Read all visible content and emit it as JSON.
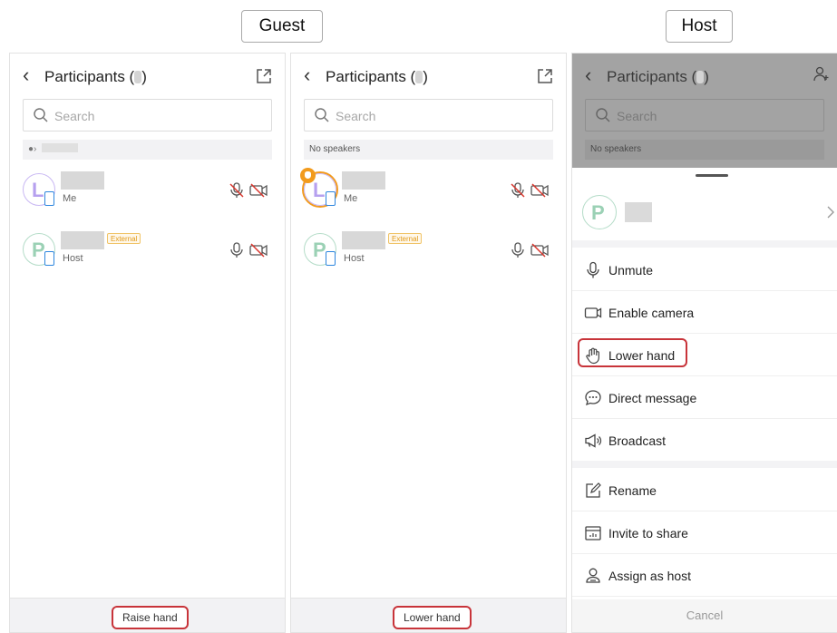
{
  "labels": {
    "guest": "Guest",
    "host": "Host"
  },
  "participants_title": "Participants (",
  "participants_title_close": ")",
  "search_placeholder": "Search",
  "no_speakers": "No speakers",
  "guest_panel_1": {
    "rows": [
      {
        "sub": "Me"
      },
      {
        "sub": "Host",
        "badge": "External"
      }
    ],
    "footer_button": "Raise hand"
  },
  "guest_panel_2": {
    "rows": [
      {
        "sub": "Me",
        "hand_raised": true
      },
      {
        "sub": "Host",
        "badge": "External"
      }
    ],
    "footer_button": "Lower hand"
  },
  "host_panel": {
    "menu": [
      {
        "icon": "mic-icon",
        "label": "Unmute"
      },
      {
        "icon": "camera-icon",
        "label": "Enable camera"
      },
      {
        "icon": "hand-icon",
        "label": "Lower hand"
      },
      {
        "icon": "chat-bubble-icon",
        "label": "Direct message"
      },
      {
        "icon": "megaphone-icon",
        "label": "Broadcast"
      },
      {
        "icon": "edit-icon",
        "label": "Rename"
      },
      {
        "icon": "share-screen-icon",
        "label": "Invite to share"
      },
      {
        "icon": "user-host-icon",
        "label": "Assign as host"
      }
    ],
    "cancel": "Cancel"
  },
  "colors": {
    "highlight": "#c8343a",
    "hand": "#f29b1d",
    "external": "#e19a1a",
    "phone": "#2e86de"
  }
}
